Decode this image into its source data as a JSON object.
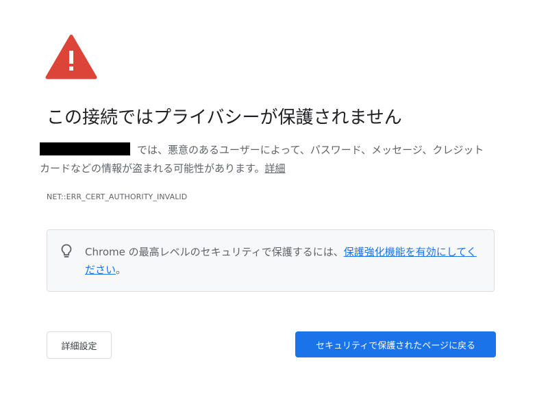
{
  "interstitial": {
    "headline": "この接続ではプライバシーが保護されません",
    "body_text": "では、悪意のあるユーザーによって、パスワード、メッセージ、クレジット カードなどの情報が盗まれる可能性があります。",
    "details_link": "詳細",
    "error_code": "NET::ERR_CERT_AUTHORITY_INVALID"
  },
  "tip": {
    "icon": "lightbulb-icon",
    "text_before": "Chrome の最高レベルのセキュリティで保護するには、",
    "link": "保護強化機能を有効にしてください",
    "text_after": "。"
  },
  "buttons": {
    "advanced_label": "詳細設定",
    "back_label": "セキュリティで保護されたページに戻る"
  },
  "colors": {
    "warning_red": "#db4437",
    "primary_blue": "#1a73e8",
    "text_gray": "#5f6368",
    "tip_background": "#f7f8fa"
  }
}
